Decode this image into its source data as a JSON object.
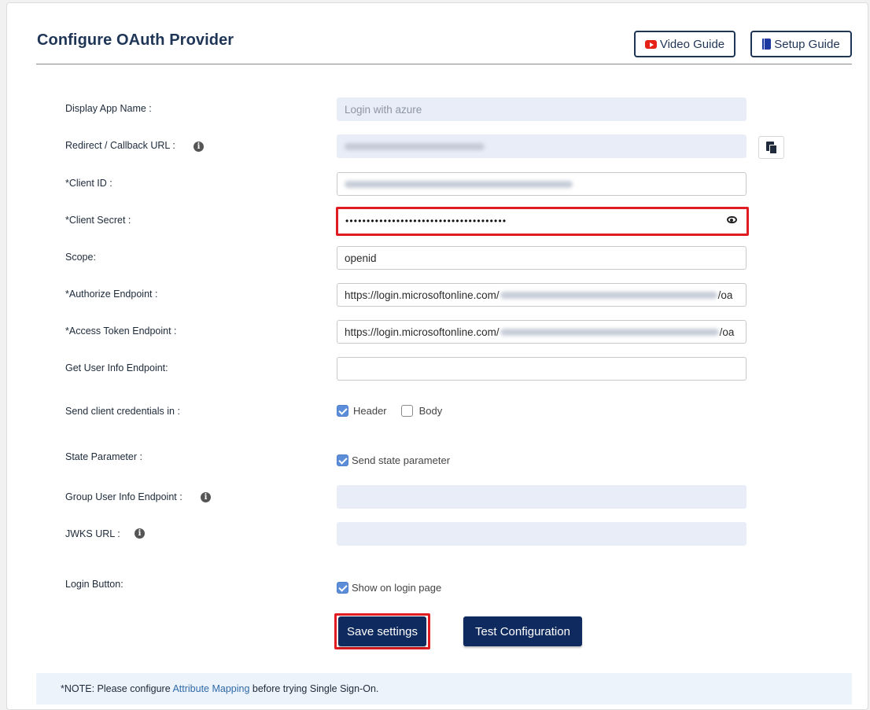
{
  "header": {
    "title": "Configure OAuth Provider",
    "video_guide": "Video Guide",
    "setup_guide": "Setup Guide"
  },
  "form": {
    "display_app_name": {
      "label": "Display App Name :",
      "placeholder": "Login with azure"
    },
    "redirect_url": {
      "label": "Redirect / Callback URL :",
      "value": "[redacted]"
    },
    "client_id": {
      "label": "*Client ID :",
      "value": "[redacted]"
    },
    "client_secret": {
      "label": "*Client Secret :",
      "value": "••••••••••••••••••••••••••••••••••••••"
    },
    "scope": {
      "label": "Scope:",
      "value": "openid"
    },
    "authorize_endpoint": {
      "label": "*Authorize Endpoint :",
      "prefix": "https://login.microsoftonline.com/",
      "suffix": "/oa"
    },
    "token_endpoint": {
      "label": "*Access Token Endpoint :",
      "prefix": "https://login.microsoftonline.com/",
      "suffix": "/oa"
    },
    "user_info_endpoint": {
      "label": "Get User Info Endpoint:",
      "value": ""
    },
    "send_credentials": {
      "label": "Send client credentials in :",
      "options": [
        {
          "label": "Header",
          "checked": true
        },
        {
          "label": "Body",
          "checked": false
        }
      ]
    },
    "state_parameter": {
      "label": "State Parameter :",
      "option": "Send state parameter",
      "checked": true
    },
    "group_user_info": {
      "label": "Group User Info Endpoint :",
      "value": ""
    },
    "jwks_url": {
      "label": "JWKS URL :",
      "value": ""
    },
    "login_button": {
      "label": "Login Button:",
      "option": "Show on login page",
      "checked": true
    }
  },
  "actions": {
    "save": "Save settings",
    "test": "Test Configuration"
  },
  "note": {
    "prefix": "*NOTE:  Please configure ",
    "link": "Attribute Mapping",
    "suffix": " before trying Single Sign-On."
  },
  "icons": [
    "youtube-icon",
    "book-icon",
    "info-icon",
    "copy-icon",
    "eye-icon",
    "checkbox-icon"
  ],
  "colors": {
    "primary": "#0f2a5f",
    "highlight": "#e11b22",
    "disabled_field": "#e8edf8"
  }
}
